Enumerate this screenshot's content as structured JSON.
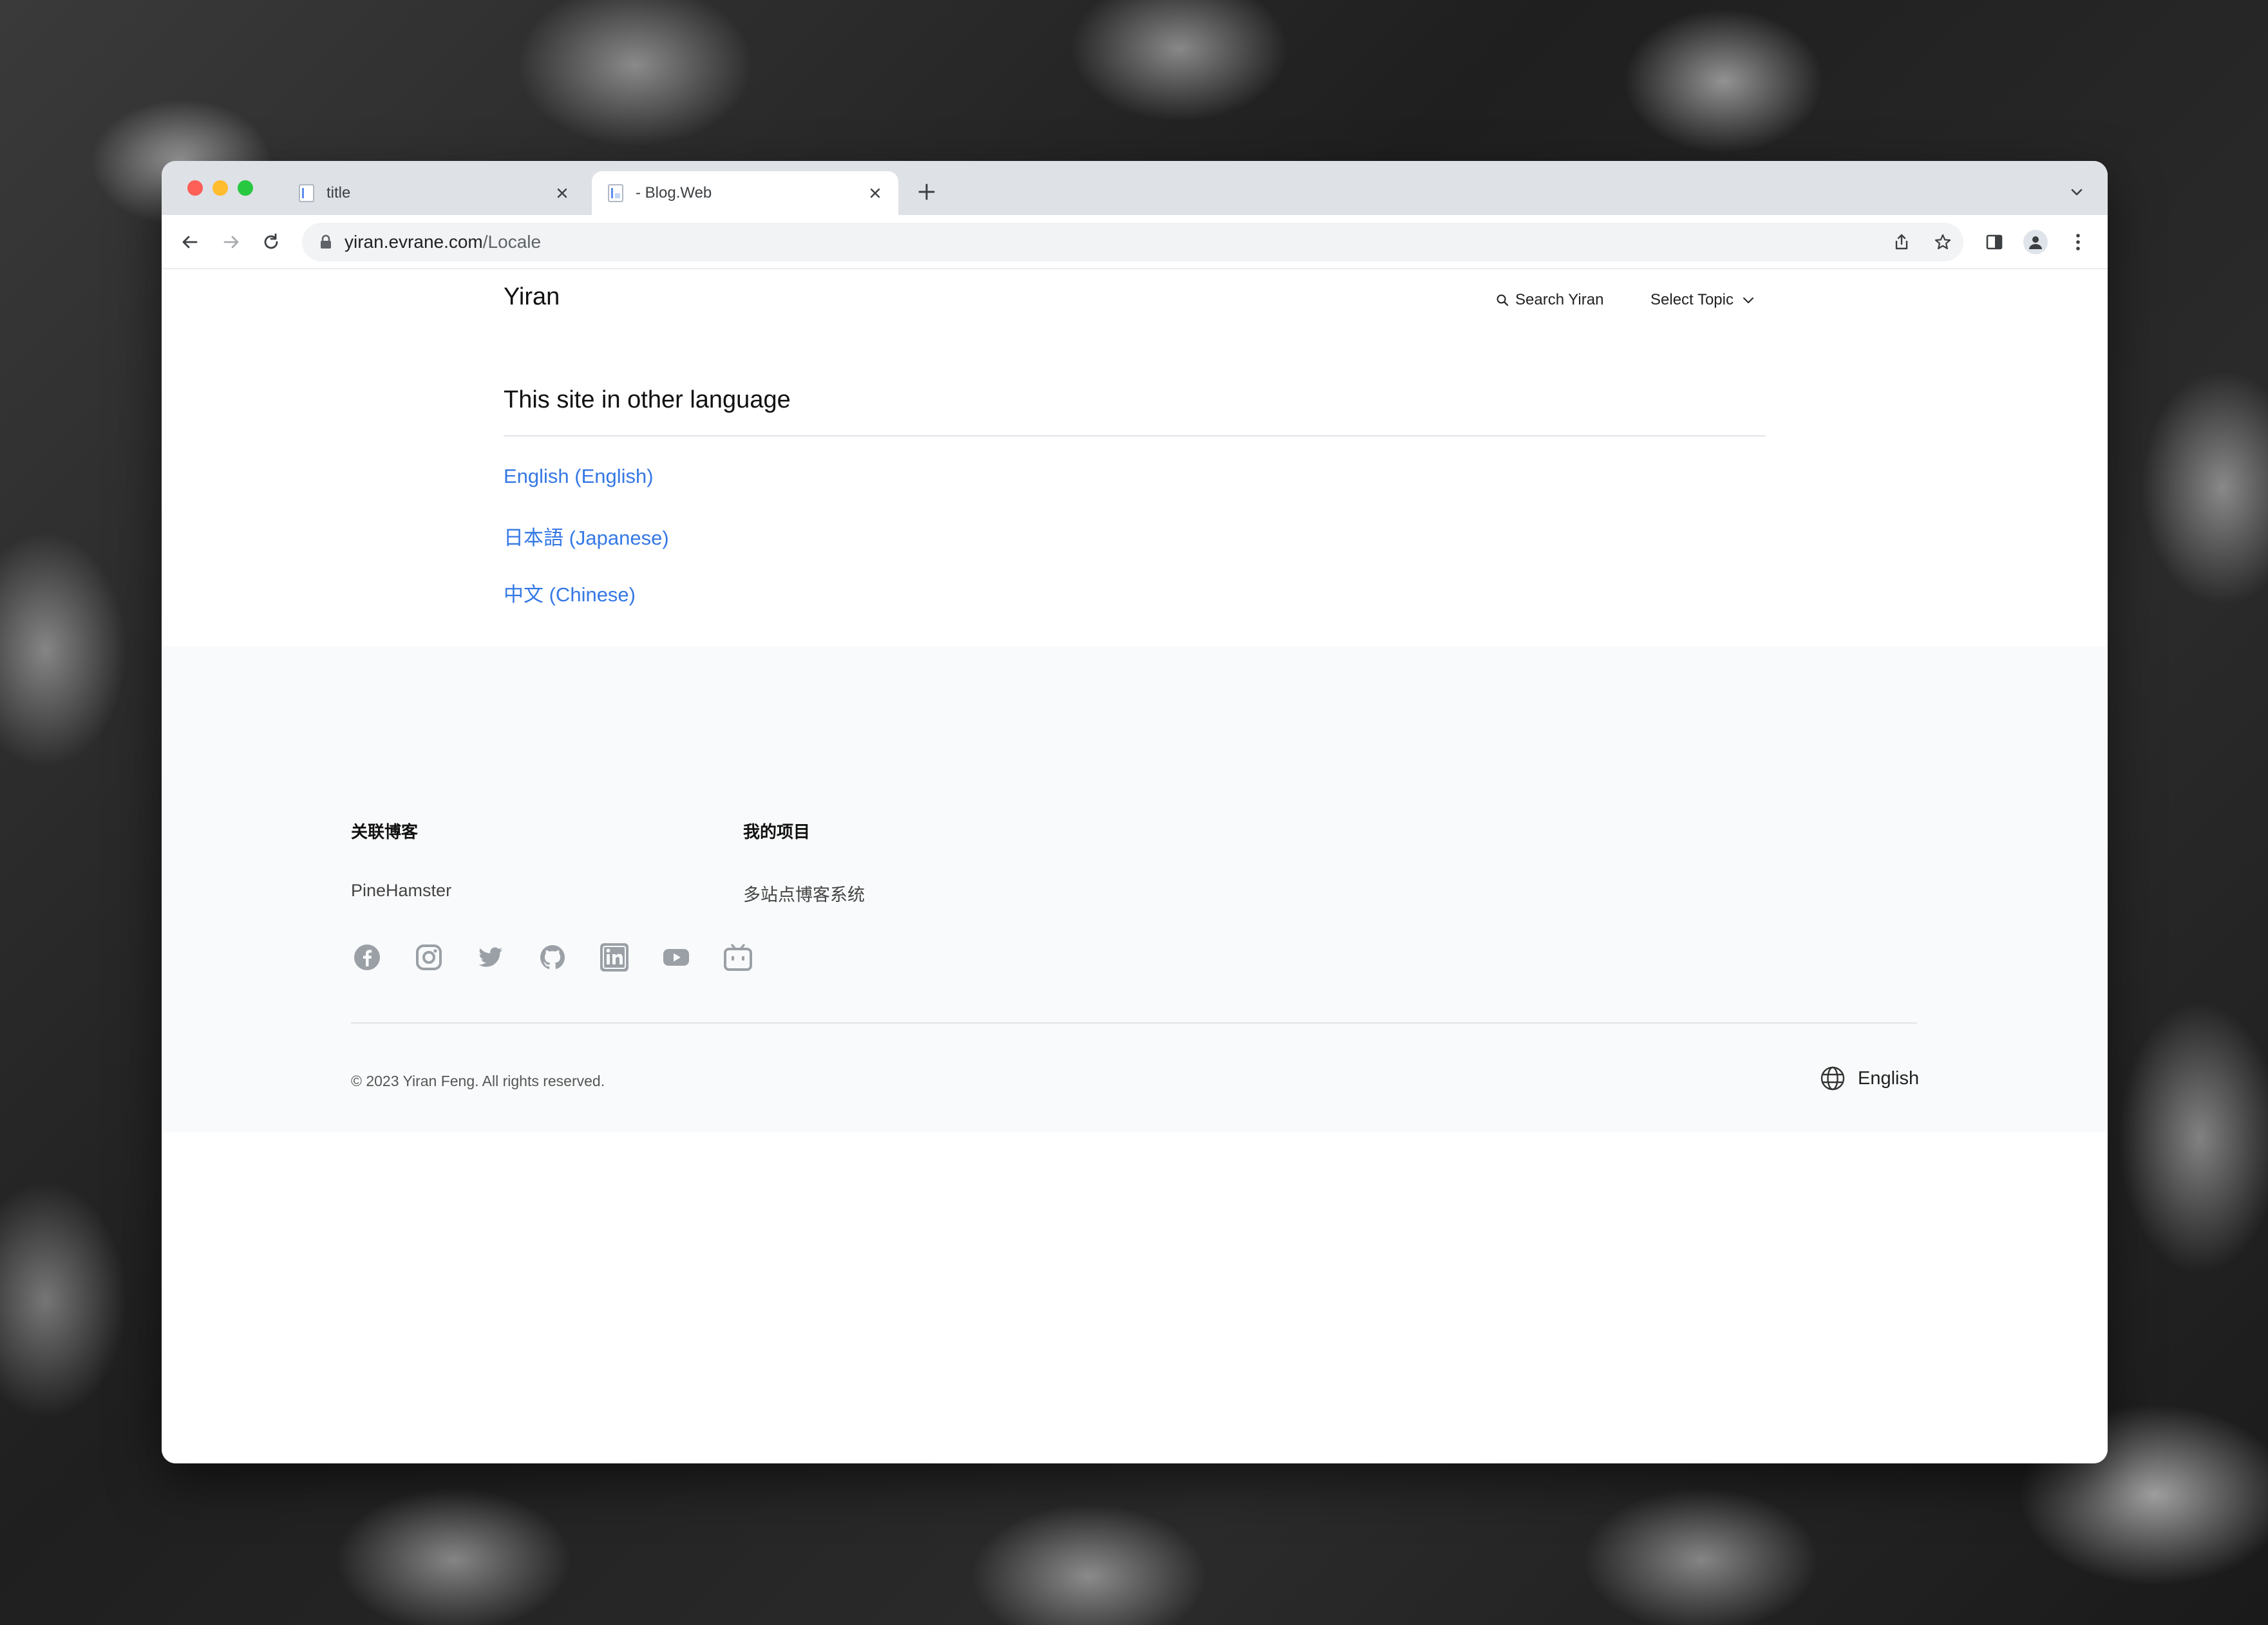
{
  "browser": {
    "tabs": [
      {
        "title": "title",
        "active": false
      },
      {
        "title": "- Blog.Web",
        "active": true
      }
    ],
    "url": {
      "host": "yiran.evrane.com",
      "path": "/Locale"
    }
  },
  "header": {
    "site_title": "Yiran",
    "search_label": "Search Yiran",
    "topic_label": "Select Topic"
  },
  "main": {
    "heading": "This site in other language",
    "languages": [
      {
        "label": "English (English)"
      },
      {
        "label": "日本語 (Japanese)"
      },
      {
        "label": "中文 (Chinese)"
      }
    ]
  },
  "footer": {
    "columns": [
      {
        "title": "关联博客",
        "links": [
          "PineHamster"
        ]
      },
      {
        "title": "我的项目",
        "links": [
          "多站点博客系统"
        ]
      }
    ],
    "social_icons": [
      "facebook-icon",
      "instagram-icon",
      "twitter-icon",
      "github-icon",
      "linkedin-icon",
      "youtube-icon",
      "bilibili-icon"
    ],
    "copyright": "© 2023 Yiran Feng. All rights reserved.",
    "language": "English"
  },
  "colors": {
    "link": "#3578e5",
    "icon_gray": "#9aa0a6",
    "tab_strip": "#dee1e6",
    "footer_bg": "#f9fafb"
  }
}
